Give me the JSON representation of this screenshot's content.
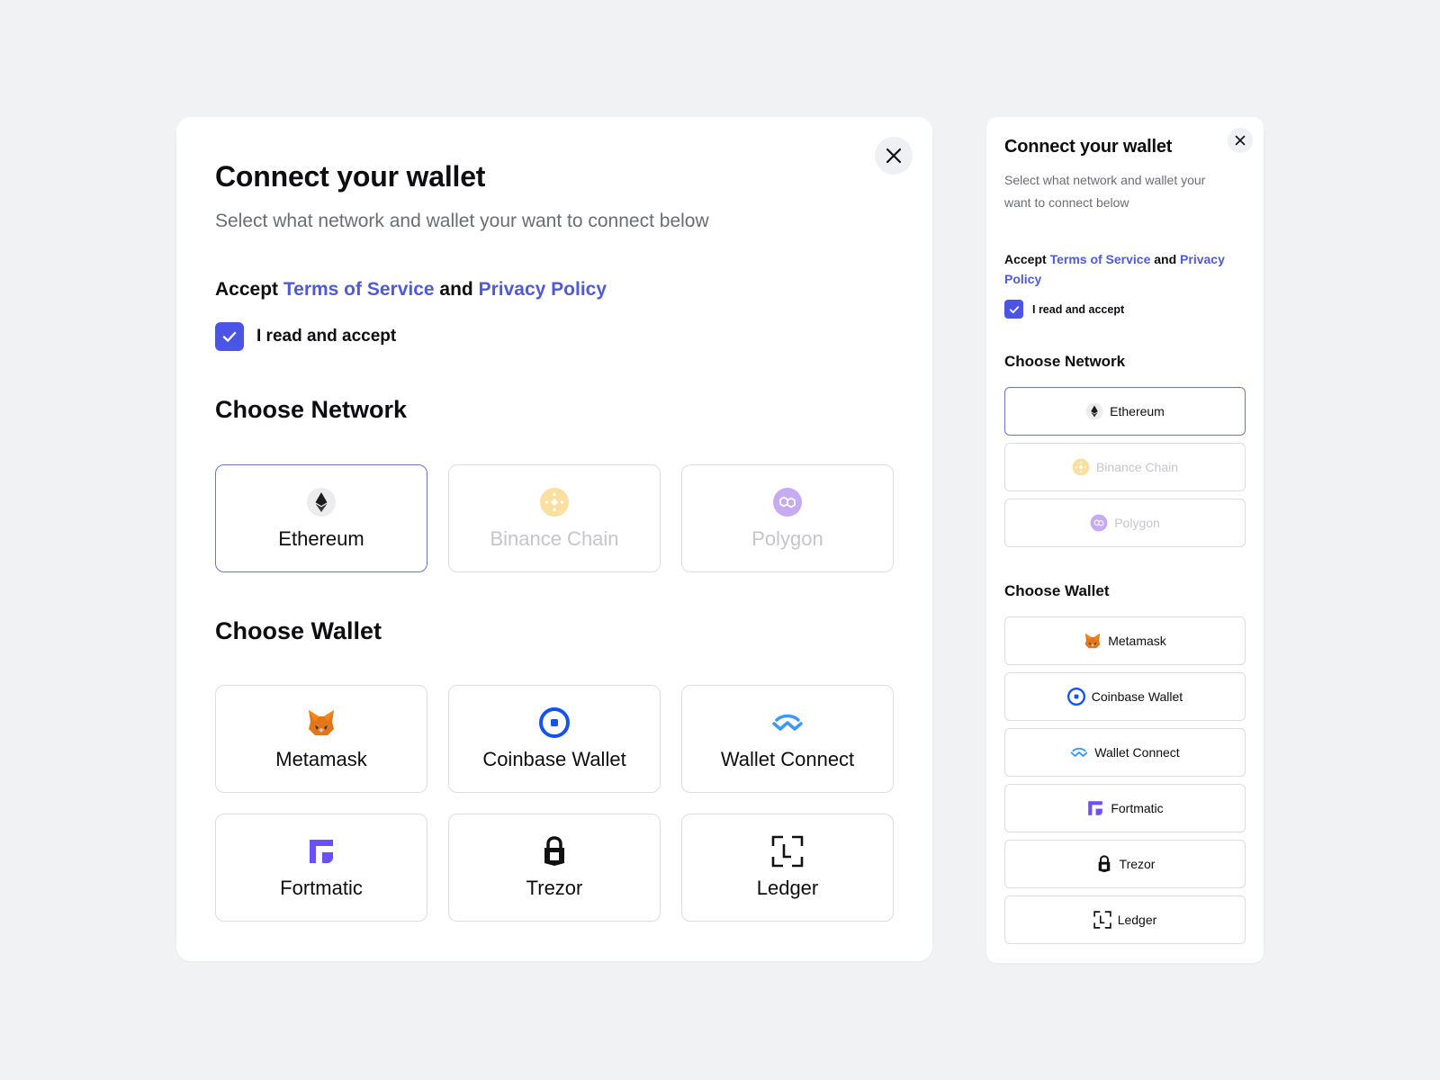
{
  "modal": {
    "title": "Connect your wallet",
    "subtitle": "Select what network and wallet your want to connect below",
    "accept": {
      "prefix": "Accept",
      "terms": "Terms of Service",
      "and": "and",
      "privacy": "Privacy Policy"
    },
    "checkbox_label": "I read and accept",
    "checkbox_checked": true,
    "network_heading": "Choose Network",
    "networks": [
      {
        "label": "Ethereum",
        "icon": "ethereum-icon",
        "state": "selected"
      },
      {
        "label": "Binance Chain",
        "icon": "binance-icon",
        "state": "disabled"
      },
      {
        "label": "Polygon",
        "icon": "polygon-icon",
        "state": "disabled"
      }
    ],
    "wallet_heading": "Choose Wallet",
    "wallets": [
      {
        "label": "Metamask",
        "icon": "metamask-fox-icon"
      },
      {
        "label": "Coinbase Wallet",
        "icon": "coinbase-icon"
      },
      {
        "label": "Wallet Connect",
        "icon": "walletconnect-icon"
      },
      {
        "label": "Fortmatic",
        "icon": "fortmatic-icon"
      },
      {
        "label": "Trezor",
        "icon": "trezor-lock-icon"
      },
      {
        "label": "Ledger",
        "icon": "ledger-icon"
      }
    ]
  },
  "colors": {
    "accent": "#4a55e8",
    "link": "#4f5bd5",
    "selected_border": "#6b72c9",
    "background": "#f1f2f4",
    "binance": "#f3ba2f",
    "polygon": "#8247e5",
    "coinbase": "#1652f0",
    "walletconnect": "#3b99fc",
    "fortmatic": "#6851ff"
  }
}
